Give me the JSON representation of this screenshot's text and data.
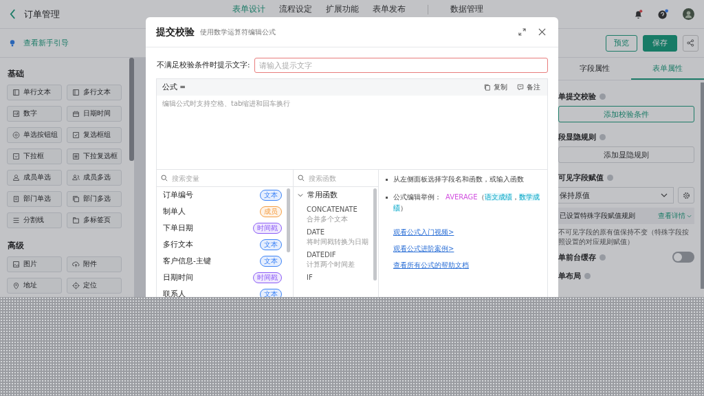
{
  "header": {
    "title": "订单管理",
    "nav": [
      {
        "label": "表单设计",
        "selected": true
      },
      {
        "label": "流程设定",
        "selected": false
      },
      {
        "label": "扩展功能",
        "selected": false
      },
      {
        "label": "表单发布",
        "selected": false
      },
      {
        "label": "数据管理",
        "selected": false
      }
    ]
  },
  "toolbar": {
    "guide": "查看新手引导",
    "preview": "预览",
    "save": "保存"
  },
  "sidebar": {
    "groups": [
      {
        "title": "基础",
        "items": [
          {
            "label": "单行文本"
          },
          {
            "label": "多行文本"
          },
          {
            "label": "数字"
          },
          {
            "label": "日期时间"
          },
          {
            "label": "单选按钮组"
          },
          {
            "label": "复选框组"
          },
          {
            "label": "下拉框"
          },
          {
            "label": "下拉复选框"
          },
          {
            "label": "成员单选"
          },
          {
            "label": "成员多选"
          },
          {
            "label": "部门单选"
          },
          {
            "label": "部门多选"
          },
          {
            "label": "分割线"
          },
          {
            "label": "多标签页"
          }
        ]
      },
      {
        "title": "高级",
        "items": [
          {
            "label": "图片"
          },
          {
            "label": "附件"
          },
          {
            "label": "地址"
          },
          {
            "label": "定位"
          }
        ]
      }
    ]
  },
  "right_panel": {
    "tabs": [
      {
        "label": "字段属性",
        "selected": false
      },
      {
        "label": "表单属性",
        "selected": true
      }
    ],
    "sections": [
      {
        "kind": "button",
        "title": "单提交校验",
        "button": "添加校验条件",
        "primary": true
      },
      {
        "kind": "button",
        "title": "段显隐规则",
        "button": "添加显隐规则",
        "primary": false
      },
      {
        "kind": "select",
        "title": "可见字段赋值",
        "value": "保持原值",
        "info": "已设置特殊字段赋值规则",
        "info_link": "查看详情",
        "note": "不可见字段的原有值保持不变（特殊字段按照设置的对应规则赋值）"
      },
      {
        "kind": "switch",
        "title": "单前台缓存",
        "on": false
      },
      {
        "kind": "heading",
        "title": "单布局"
      }
    ]
  },
  "modal": {
    "title": "提交校验",
    "subtitle": "使用数学运算符编辑公式",
    "message_label": "不满足校验条件时提示文字:",
    "message_placeholder": "请输入提示文字",
    "formula_label": "公式 =",
    "copy": "复制",
    "note": "备注",
    "formula_placeholder": "编辑公式时支持空格、tab缩进和回车换行",
    "variable_search": {
      "placeholder": "搜索变量"
    },
    "variables": [
      {
        "name": "订单编号",
        "type": "文本",
        "color": "#3b82f6"
      },
      {
        "name": "制单人",
        "type": "成员",
        "color": "#f59e42"
      },
      {
        "name": "下单日期",
        "type": "时间戳",
        "color": "#8b5cf6"
      },
      {
        "name": "多行文本",
        "type": "文本",
        "color": "#3b82f6"
      },
      {
        "name": "客户信息-主键",
        "type": "文本",
        "color": "#3b82f6"
      },
      {
        "name": "日期时间",
        "type": "时间戳",
        "color": "#8b5cf6"
      },
      {
        "name": "联系人",
        "type": "文本",
        "color": "#3b82f6"
      }
    ],
    "function_search": {
      "placeholder": "搜索函数"
    },
    "function_group": {
      "label": "常用函数",
      "expanded": true,
      "items": [
        {
          "name": "CONCATENATE",
          "desc": "合并多个文本"
        },
        {
          "name": "DATE",
          "desc": "将时间戳转换为日期"
        },
        {
          "name": "DATEDIF",
          "desc": "计算两个时间差"
        },
        {
          "name": "IF"
        }
      ]
    },
    "help": {
      "tip": "从左侧面板选择字段名和函数，或输入函数",
      "example_label": "公式编辑举例：",
      "example": [
        {
          "kind": "function",
          "text": "AVERAGE"
        },
        {
          "kind": "plain",
          "text": "（"
        },
        {
          "kind": "field",
          "text": "语文成绩"
        },
        {
          "kind": "plain",
          "text": "，"
        },
        {
          "kind": "field",
          "text": "数学成绩"
        },
        {
          "kind": "plain",
          "text": "）"
        }
      ],
      "links": [
        "观看公式入门视频>",
        "观看公式进阶案例>",
        "查看所有公式的帮助文档"
      ]
    }
  }
}
